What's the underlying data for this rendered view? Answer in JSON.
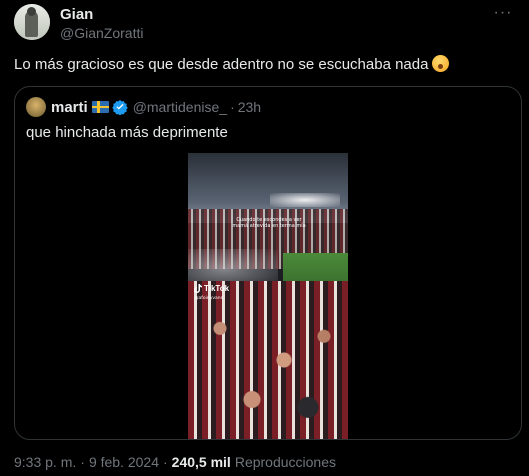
{
  "author": {
    "display_name": "Gian",
    "handle": "@GianZoratti"
  },
  "tweet": {
    "text": "Lo más gracioso es que desde adentro no se escuchaba nada",
    "emoji_icon": "astonished-face-emoji"
  },
  "quote": {
    "display_name": "marti",
    "flag_icon": "sweden-flag-emoji",
    "verified_icon": "verified-badge-icon",
    "handle": "@martidenise_",
    "separator": "·",
    "time": "23h",
    "text": "que hinchada más deprimente",
    "video": {
      "caption": "Cuando te escondes a ver mamá atrevida en terma mía",
      "tiktok_label": "TikTok",
      "tiktok_handle": "@afoinyvans"
    }
  },
  "meta": {
    "time": "9:33 p. m.",
    "separator": "·",
    "date": "9 feb. 2024",
    "separator2": "·",
    "views_count": "240,5 mil",
    "views_label": "Reproducciones"
  },
  "colors": {
    "background": "#000000",
    "text_primary": "#e7e9ea",
    "text_secondary": "#71767b",
    "border": "#2f3336",
    "verified": "#1d9bf0"
  }
}
